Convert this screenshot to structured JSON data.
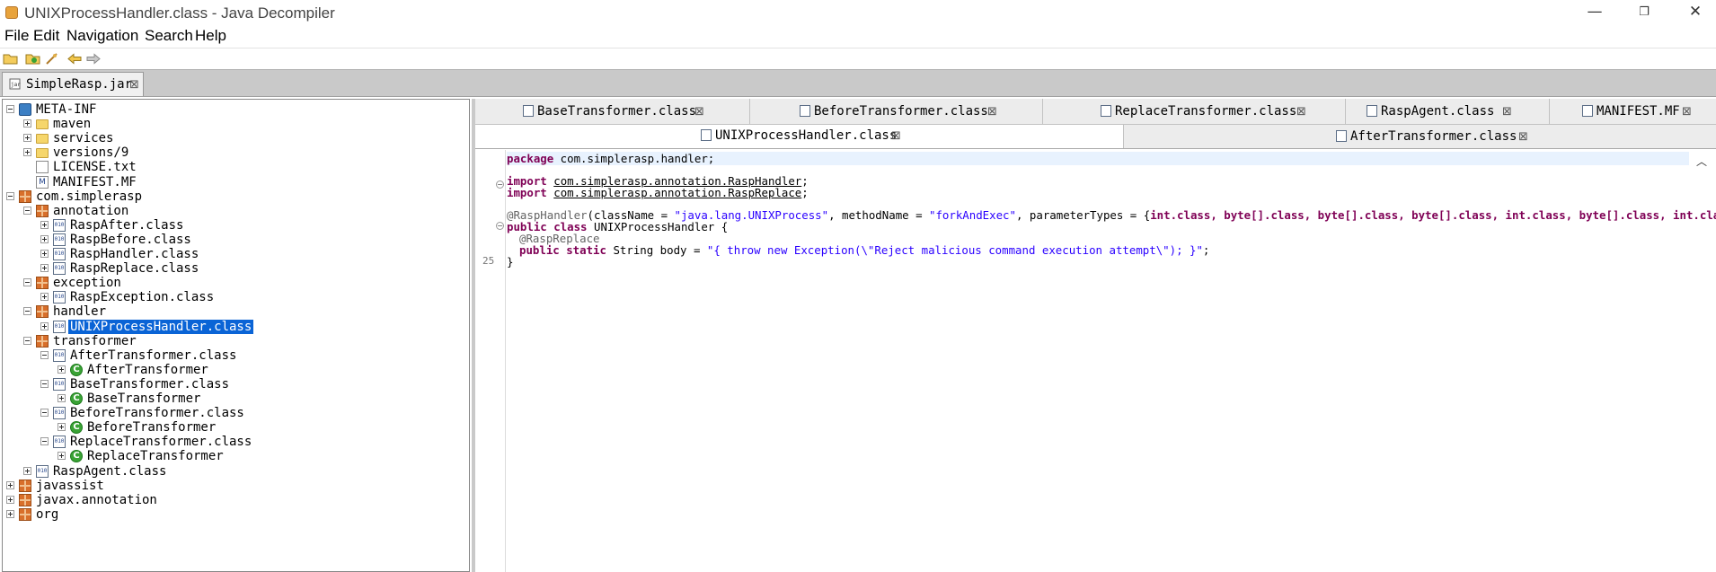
{
  "window": {
    "title": "UNIXProcessHandler.class - Java Decompiler",
    "minimize": "—",
    "maximize": "❐",
    "close": "✕"
  },
  "menu": [
    "File",
    "Edit",
    "Navigation",
    "Search",
    "Help"
  ],
  "jar_tab": {
    "label": "SimpleRasp.jar",
    "close": "⊠"
  },
  "tree": [
    {
      "label": "META-INF",
      "icon": "globe-icon"
    },
    {
      "label": "maven",
      "icon": "folder-icon"
    },
    {
      "label": "services",
      "icon": "folder-icon"
    },
    {
      "label": "versions/9",
      "icon": "folder-icon"
    },
    {
      "label": "LICENSE.txt",
      "icon": "file-icon"
    },
    {
      "label": "MANIFEST.MF",
      "icon": "manifest-icon"
    },
    {
      "label": "com.simplerasp",
      "icon": "package-icon"
    },
    {
      "label": "annotation",
      "icon": "package-icon"
    },
    {
      "label": "RaspAfter.class",
      "icon": "class-file-icon"
    },
    {
      "label": "RaspBefore.class",
      "icon": "class-file-icon"
    },
    {
      "label": "RaspHandler.class",
      "icon": "class-file-icon"
    },
    {
      "label": "RaspReplace.class",
      "icon": "class-file-icon"
    },
    {
      "label": "exception",
      "icon": "package-icon"
    },
    {
      "label": "RaspException.class",
      "icon": "class-file-icon"
    },
    {
      "label": "handler",
      "icon": "package-icon"
    },
    {
      "label": "UNIXProcessHandler.class",
      "icon": "class-file-icon"
    },
    {
      "label": "transformer",
      "icon": "package-icon"
    },
    {
      "label": "AfterTransformer.class",
      "icon": "class-file-icon"
    },
    {
      "label": "AfterTransformer",
      "icon": "class-type-icon"
    },
    {
      "label": "BaseTransformer.class",
      "icon": "class-file-icon"
    },
    {
      "label": "BaseTransformer",
      "icon": "class-type-icon"
    },
    {
      "label": "BeforeTransformer.class",
      "icon": "class-file-icon"
    },
    {
      "label": "BeforeTransformer",
      "icon": "class-type-icon"
    },
    {
      "label": "ReplaceTransformer.class",
      "icon": "class-file-icon"
    },
    {
      "label": "ReplaceTransformer",
      "icon": "class-type-icon"
    },
    {
      "label": "RaspAgent.class",
      "icon": "class-file-icon"
    },
    {
      "label": "javassist",
      "icon": "package-icon"
    },
    {
      "label": "javax.annotation",
      "icon": "package-icon"
    },
    {
      "label": "org",
      "icon": "package-icon"
    }
  ],
  "editor_tabs_row1": [
    {
      "label": "BaseTransformer.class"
    },
    {
      "label": "BeforeTransformer.class"
    },
    {
      "label": "ReplaceTransformer.class"
    },
    {
      "label": "RaspAgent.class"
    },
    {
      "label": "MANIFEST.MF"
    }
  ],
  "editor_tabs_row2": [
    {
      "label": "UNIXProcessHandler.class",
      "active": true
    },
    {
      "label": "AfterTransformer.class"
    }
  ],
  "tab_close": "⊠",
  "code": {
    "line1_kw": "package",
    "line1_rest": " com.simplerasp.handler;",
    "line2_kw": "import",
    "line2_path": "com.simplerasp.annotation.RaspHandler",
    "line3_kw": "import",
    "line3_path": "com.simplerasp.annotation.RaspReplace",
    "semicolon": ";",
    "line4_ann": "@RaspHandler",
    "line4_a": "(className = ",
    "line4_s1": "\"java.lang.UNIXProcess\"",
    "line4_b": ", methodName = ",
    "line4_s2": "\"forkAndExec\"",
    "line4_c": ", parameterTypes = {",
    "line4_types": "int.class, byte[].class, byte[].class, byte[].class, int.class, byte[].class, int.class, byt",
    "line5_kw": "public class",
    "line5_rest": " UNIXProcessHandler {",
    "line6_ann": "@RaspReplace",
    "line7_kw": "public static",
    "line7_a": " String body = ",
    "line7_str": "\"{ throw new Exception(\\\"Reject malicious command execution attempt\\\"); }\"",
    "line7_end": ";",
    "line8": "}",
    "line_number_25": "25"
  }
}
